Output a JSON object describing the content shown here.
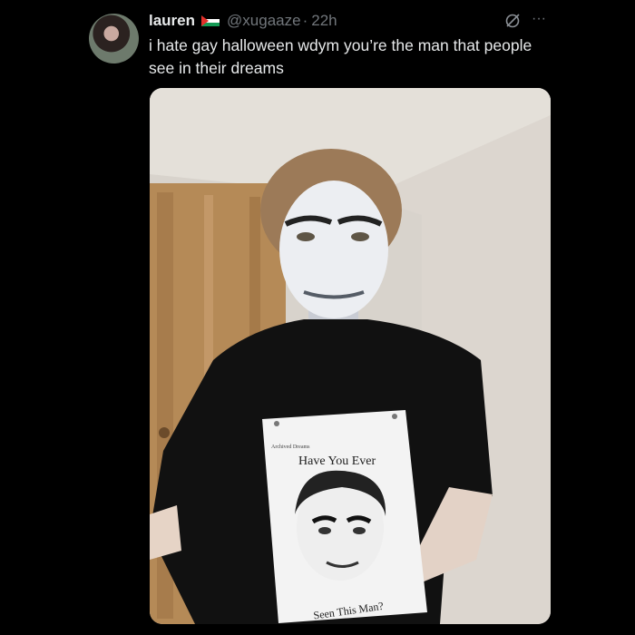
{
  "tweet": {
    "author_name": "lauren",
    "flag": "palestine-flag",
    "handle": "@xugaaze",
    "separator": "·",
    "time": "22h",
    "text": "i hate gay halloween wdym you’re the man that people see in their dreams",
    "more_label": "···"
  },
  "photo": {
    "sign_header": "Archived Dreams",
    "sign_title": "Have You Ever",
    "sign_footer": "Seen This Man?"
  }
}
